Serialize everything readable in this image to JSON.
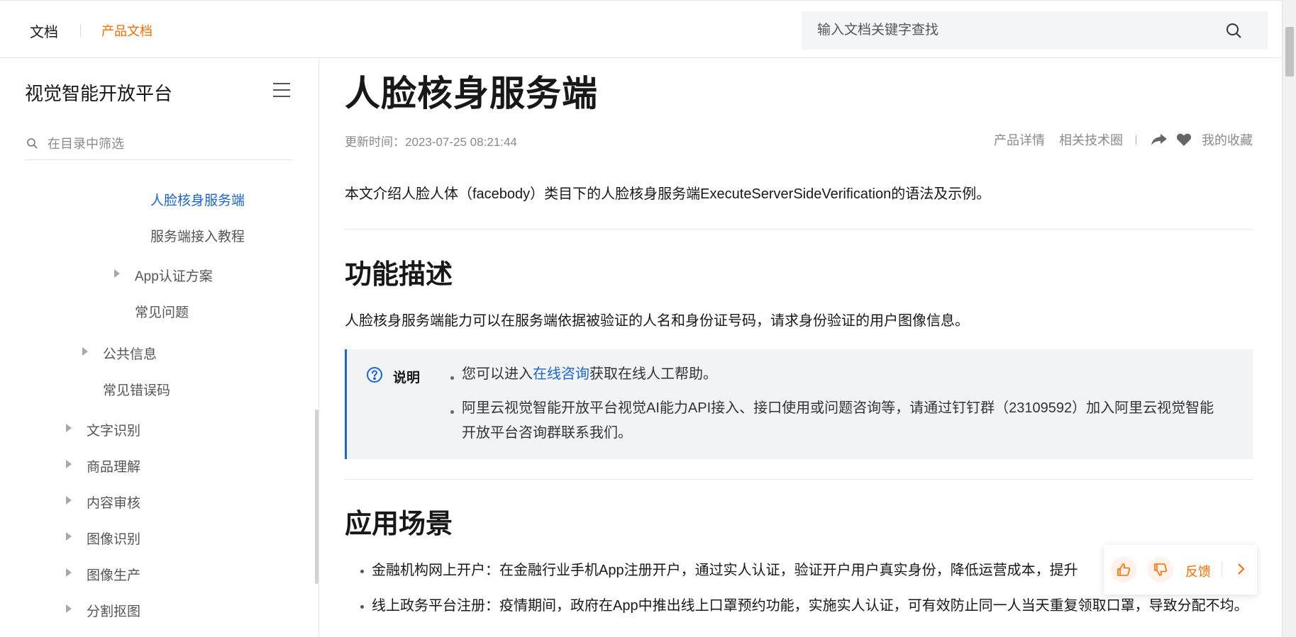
{
  "header": {
    "brand": "文档",
    "product_docs": "产品文档",
    "search_placeholder": "输入文档关键字查找"
  },
  "sidebar": {
    "title": "视觉智能开放平台",
    "filter_placeholder": "在目录中筛选",
    "items": [
      {
        "label": "人脸核身服务端",
        "active": true
      },
      {
        "label": "服务端接入教程"
      },
      {
        "label": "App认证方案",
        "expandable": true
      },
      {
        "label": "常见问题"
      },
      {
        "label": "公共信息",
        "expandable": true
      },
      {
        "label": "常见错误码"
      },
      {
        "label": "文字识别",
        "expandable": true
      },
      {
        "label": "商品理解",
        "expandable": true
      },
      {
        "label": "内容审核",
        "expandable": true
      },
      {
        "label": "图像识别",
        "expandable": true
      },
      {
        "label": "图像生产",
        "expandable": true
      },
      {
        "label": "分割抠图",
        "expandable": true
      }
    ]
  },
  "article": {
    "title": "人脸核身服务端",
    "updated": "更新时间：2023-07-25 08:21:44",
    "links": {
      "product_details": "产品详情",
      "tech_circle": "相关技术圈",
      "favorites": "我的收藏"
    },
    "intro": "本文介绍人脸人体（facebody）类目下的人脸核身服务端ExecuteServerSideVerification的语法及示例。",
    "section1": {
      "heading": "功能描述",
      "text": "人脸核身服务端能力可以在服务端依据被验证的人名和身份证号码，请求身份验证的用户图像信息。"
    },
    "note": {
      "title": "说明",
      "item1_before": "您可以进入",
      "item1_link": "在线咨询",
      "item1_after": "获取在线人工帮助。",
      "item2": "阿里云视觉智能开放平台视觉AI能力API接入、接口使用或问题咨询等，请通过钉钉群（23109592）加入阿里云视觉智能开放平台咨询群联系我们。"
    },
    "section2": {
      "heading": "应用场景",
      "bullets": [
        "金融机构网上开户：在金融行业手机App注册开户，通过实人认证，验证开户用户真实身份，降低运营成本，提升",
        "线上政务平台注册：疫情期间，政府在App中推出线上口罩预约功能，实施实人认证，可有效防止同一人当天重复领取口罩，导致分配不均。"
      ]
    }
  },
  "feedback": {
    "label": "反馈"
  },
  "colors": {
    "accent": "#ff6a00",
    "link": "#1a66d6"
  }
}
